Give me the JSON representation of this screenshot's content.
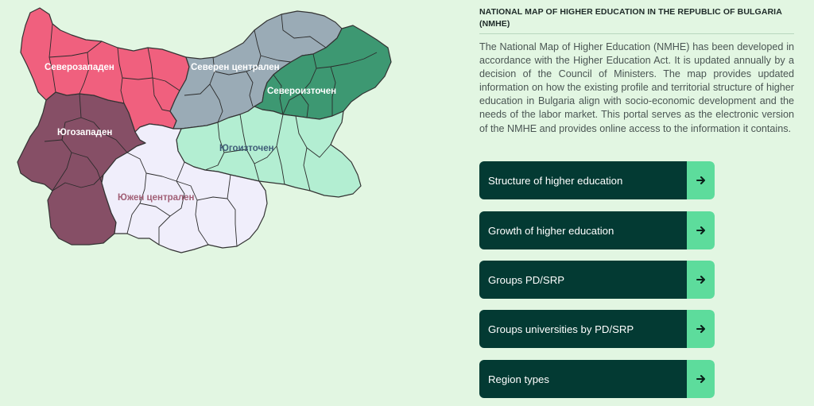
{
  "map": {
    "regions": [
      {
        "id": "nw",
        "label": "Северозападен",
        "fill": "#f0607e",
        "label_color": "#ffffff"
      },
      {
        "id": "nc",
        "label": "Северен централен",
        "fill": "#9aabb6",
        "label_color": "#ffffff"
      },
      {
        "id": "ne",
        "label": "Североизточен",
        "fill": "#3d9872",
        "label_color": "#ffffff"
      },
      {
        "id": "sw",
        "label": "Югозападен",
        "fill": "#864f66",
        "label_color": "#ffffff"
      },
      {
        "id": "se",
        "label": "Югоизточен",
        "fill": "#b3eed2",
        "label_color": "#3f5d78"
      },
      {
        "id": "sc",
        "label": "Южен централен",
        "fill": "#f0eefb",
        "label_color": "#a15f76"
      }
    ]
  },
  "info": {
    "title": "NATIONAL MAP OF HIGHER EDUCATION IN THE REPUBLIC OF BULGARIA (NMHE)",
    "description": "The National Map of Higher Education (NMHE) has been developed in accordance with the Higher Education Act. It is updated annually by a decision of the Council of Ministers. The map provides updated information on how the existing profile and territorial structure of higher education in Bulgaria align with socio-economic development and the needs of the labor market. This portal serves as the electronic version of the NMHE and provides online access to the information it contains."
  },
  "buttons": [
    {
      "label": "Structure of higher education",
      "icon": "arrow-right-icon"
    },
    {
      "label": "Growth of higher education",
      "icon": "arrow-right-icon"
    },
    {
      "label": "Groups PD/SRP",
      "icon": "arrow-right-icon"
    },
    {
      "label": "Groups universities by PD/SRP",
      "icon": "arrow-right-icon"
    },
    {
      "label": "Region types",
      "icon": "arrow-right-icon"
    }
  ],
  "colors": {
    "button_bg": "#033a33",
    "button_accent": "#5ddc9c",
    "page_bg": "#e2f6e2"
  }
}
